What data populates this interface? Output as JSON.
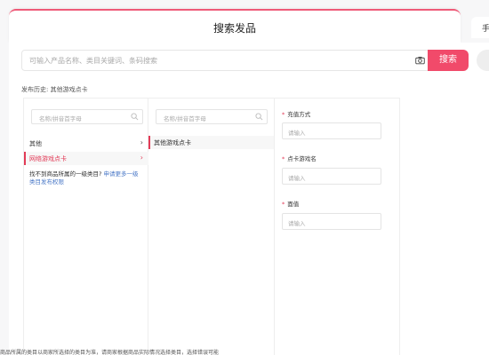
{
  "tab": {
    "title": "搜索发品",
    "right_label": "手"
  },
  "search": {
    "placeholder": "可输入产品名称、类目关键词、条码搜索",
    "button_label": "搜索"
  },
  "history": {
    "label": "发布历史: 其他游戏点卡"
  },
  "category": {
    "search_placeholder": "名称/拼音首字母",
    "items": [
      {
        "label": "其他",
        "active": false
      },
      {
        "label": "网络游戏点卡",
        "active": true
      }
    ],
    "help_text": "找不到商品所属的一级类目?",
    "help_link": "申请更多一级类目发布权限"
  },
  "subcategory": {
    "search_placeholder": "名称/拼音首字母",
    "selected": "其他游戏点卡"
  },
  "fields": [
    {
      "label": "充值方式",
      "placeholder": "请输入"
    },
    {
      "label": "点卡游戏名",
      "placeholder": "请输入"
    },
    {
      "label": "面值",
      "placeholder": "请输入"
    }
  ],
  "footer_text": "商品所属的类目以商家所选择的类目为准，请商家根据商品实际情况选择类目，选择错误可能"
}
